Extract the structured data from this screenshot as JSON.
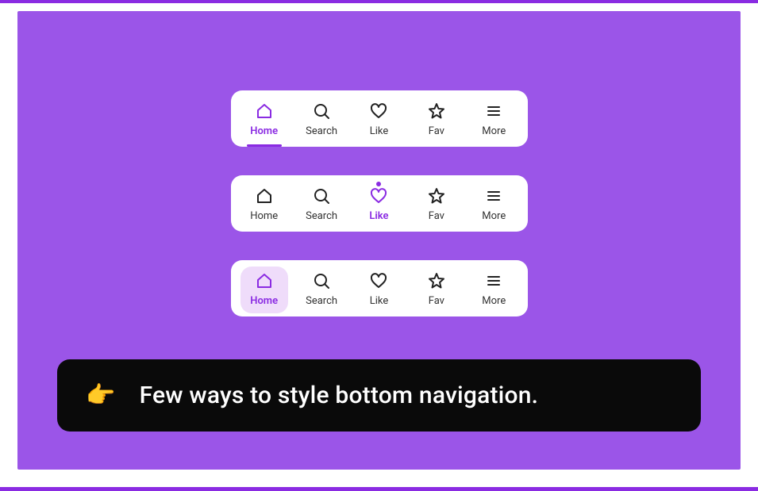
{
  "colors": {
    "accent": "#8A2BE2",
    "stage": "#9b55e8",
    "pill": "#efdcfa"
  },
  "nav": {
    "items": [
      {
        "label": "Home",
        "icon": "home-icon"
      },
      {
        "label": "Search",
        "icon": "search-icon"
      },
      {
        "label": "Like",
        "icon": "heart-icon"
      },
      {
        "label": "Fav",
        "icon": "star-icon"
      },
      {
        "label": "More",
        "icon": "more-icon"
      }
    ],
    "variants": [
      {
        "style": "underline",
        "active_index": 0
      },
      {
        "style": "notch",
        "active_index": 2
      },
      {
        "style": "pill",
        "active_index": 0
      }
    ]
  },
  "caption": {
    "emoji": "👉",
    "text": "Few ways to style bottom navigation."
  }
}
